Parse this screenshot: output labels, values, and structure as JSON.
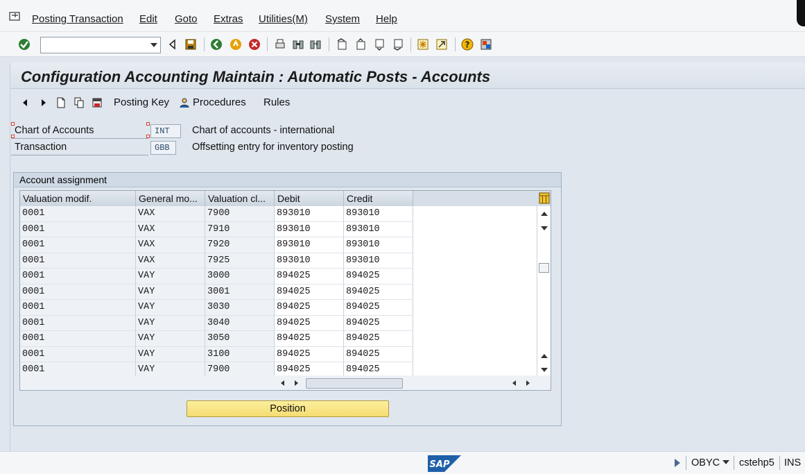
{
  "menu": {
    "items": [
      {
        "label": "Posting Transaction"
      },
      {
        "label": "Edit"
      },
      {
        "label": "Goto"
      },
      {
        "label": "Extras"
      },
      {
        "label": "Utilities(M)"
      },
      {
        "label": "System"
      },
      {
        "label": "Help"
      }
    ]
  },
  "toolbar": {
    "command_field_value": ""
  },
  "screen": {
    "title": "Configuration Accounting Maintain : Automatic Posts - Accounts"
  },
  "app_toolbar": {
    "posting_key_label": "Posting Key",
    "procedures_label": "Procedures",
    "rules_label": "Rules"
  },
  "header": {
    "chart_of_accounts": {
      "label": "Chart of Accounts",
      "value": "INT",
      "description": "Chart of accounts - international"
    },
    "transaction": {
      "label": "Transaction",
      "value": "GBB",
      "description": "Offsetting entry for inventory posting"
    }
  },
  "account_assignment": {
    "title": "Account assignment",
    "columns": [
      "Valuation modif.",
      "General mo...",
      "Valuation cl...",
      "Debit",
      "Credit"
    ],
    "rows": [
      [
        "0001",
        "VAX",
        "7900",
        "893010",
        "893010"
      ],
      [
        "0001",
        "VAX",
        "7910",
        "893010",
        "893010"
      ],
      [
        "0001",
        "VAX",
        "7920",
        "893010",
        "893010"
      ],
      [
        "0001",
        "VAX",
        "7925",
        "893010",
        "893010"
      ],
      [
        "0001",
        "VAY",
        "3000",
        "894025",
        "894025"
      ],
      [
        "0001",
        "VAY",
        "3001",
        "894025",
        "894025"
      ],
      [
        "0001",
        "VAY",
        "3030",
        "894025",
        "894025"
      ],
      [
        "0001",
        "VAY",
        "3040",
        "894025",
        "894025"
      ],
      [
        "0001",
        "VAY",
        "3050",
        "894025",
        "894025"
      ],
      [
        "0001",
        "VAY",
        "3100",
        "894025",
        "894025"
      ],
      [
        "0001",
        "VAY",
        "7900",
        "894025",
        "894025"
      ]
    ],
    "position_button": "Position"
  },
  "statusbar": {
    "logo_text": "SAP",
    "transaction_code": "OBYC",
    "server": "cstehp5",
    "mode": "INS"
  },
  "colors": {
    "background": "#dfe6ee",
    "position_button": "#f6dc72",
    "accent_blue": "#1f5fa8"
  }
}
